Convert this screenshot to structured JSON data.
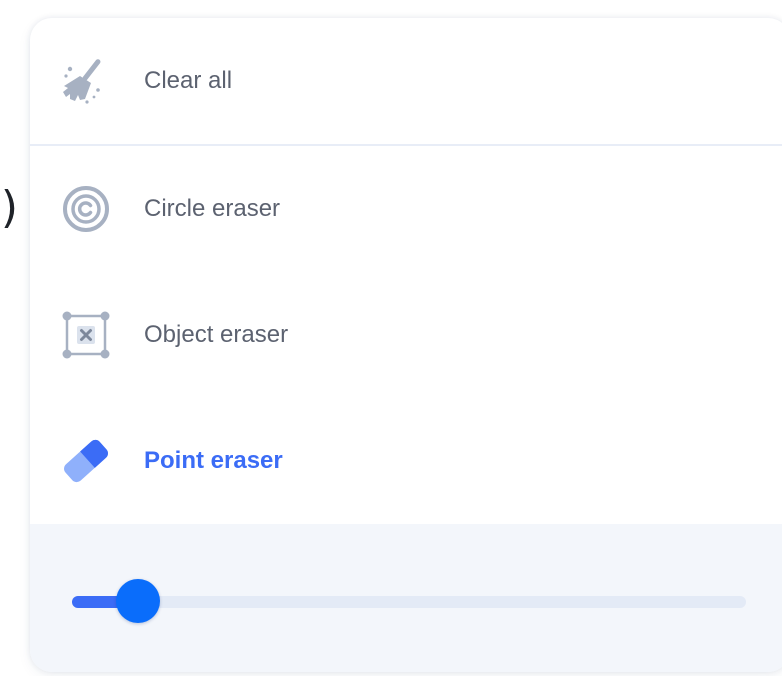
{
  "background": {
    "glyph_top": ":)",
    "glyph_bottom": ")"
  },
  "menu": {
    "items": [
      {
        "label": "Clear all",
        "icon": "broom-icon",
        "active": false
      },
      {
        "label": "Circle eraser",
        "icon": "circle-eraser-icon",
        "active": false
      },
      {
        "label": "Object eraser",
        "icon": "object-eraser-icon",
        "active": false
      },
      {
        "label": "Point eraser",
        "icon": "eraser-icon",
        "active": true
      }
    ]
  },
  "eraser_size": {
    "value_fraction": 0.07
  },
  "colors": {
    "accent": "#3b6cf6",
    "thumb": "#0a6dfb",
    "icon_gray": "#a7b1c2",
    "label_gray": "#5c6270",
    "panel_bg": "#f3f6fb",
    "track": "#e3eaf6"
  }
}
